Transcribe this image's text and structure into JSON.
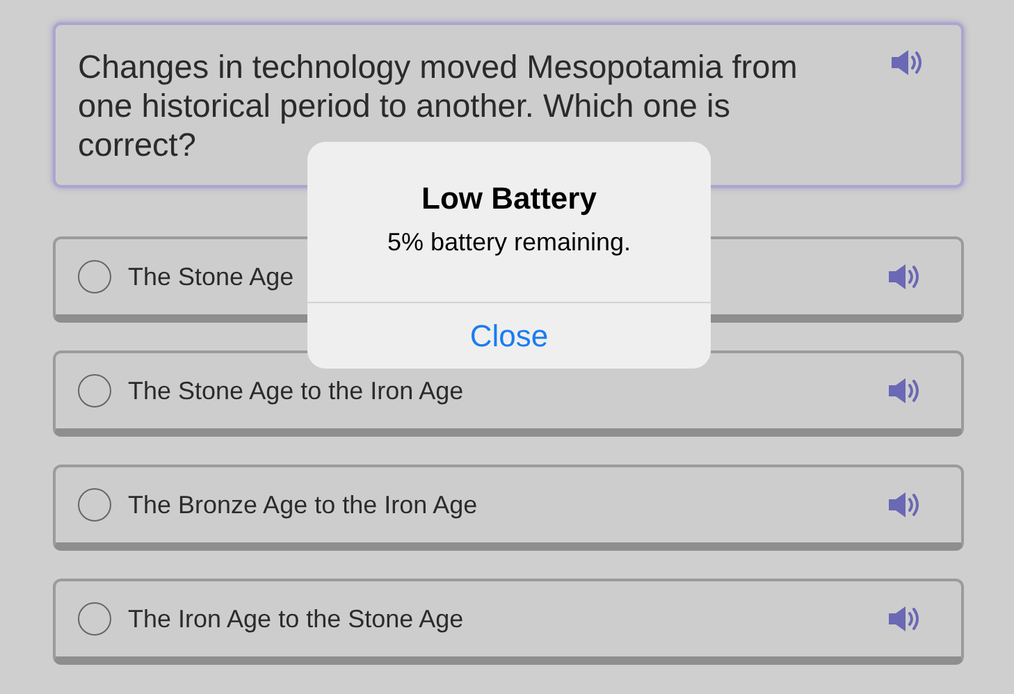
{
  "question": {
    "text": "Changes in technology moved Mesopotamia from one historical period to another. Which one is correct?"
  },
  "options": [
    {
      "label": "The Stone Age",
      "selected": false
    },
    {
      "label": "The Stone Age to the Iron Age",
      "selected": false
    },
    {
      "label": "The Bronze Age to the Iron Age",
      "selected": false
    },
    {
      "label": "The Iron Age to the Stone Age",
      "selected": false
    }
  ],
  "alert": {
    "title": "Low Battery",
    "message": "5% battery remaining.",
    "button": "Close"
  }
}
